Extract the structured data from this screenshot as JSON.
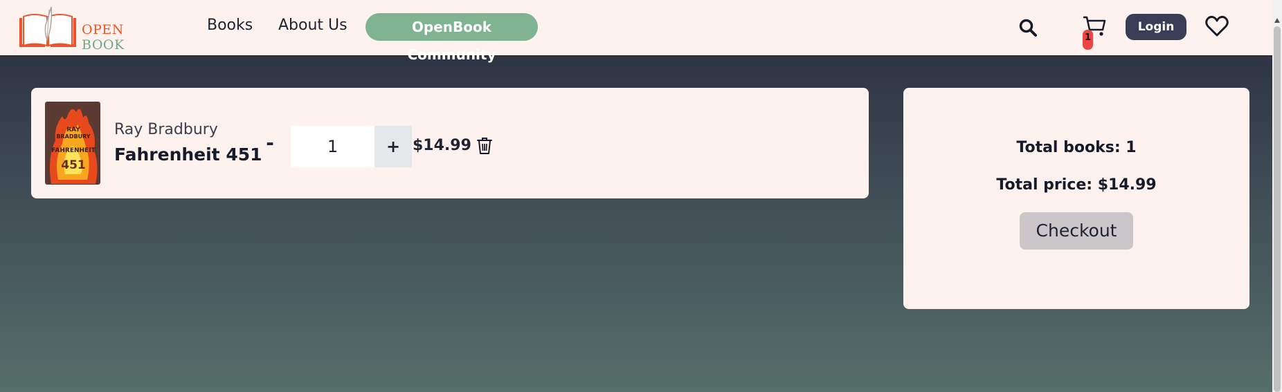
{
  "header": {
    "logo": {
      "word1": "OPEN",
      "word2": "BOOK"
    },
    "nav": {
      "books": "Books",
      "about": "About Us",
      "community": "OpenBook Community"
    },
    "cart_count": "1",
    "login_label": "Login",
    "icons": [
      "search-icon",
      "cart-icon",
      "heart-icon"
    ]
  },
  "cart": {
    "items": [
      {
        "author": "Ray Bradbury",
        "title": "Fahrenheit 451",
        "quantity": "1",
        "minus_label": "-",
        "plus_label": "+",
        "price": "$14.99",
        "cover_text": [
          "RAY",
          "BRADBURY",
          "FAHRENHEIT",
          "451"
        ]
      }
    ]
  },
  "summary": {
    "total_books": "Total books: 1",
    "total_price": "Total price: $14.99",
    "checkout_label": "Checkout"
  },
  "colors": {
    "accent_orange": "#f0532b",
    "accent_green": "#7fb392",
    "login_bg": "#3a3d56",
    "card_bg": "#fdf2ee",
    "badge_red": "#ef4444"
  }
}
